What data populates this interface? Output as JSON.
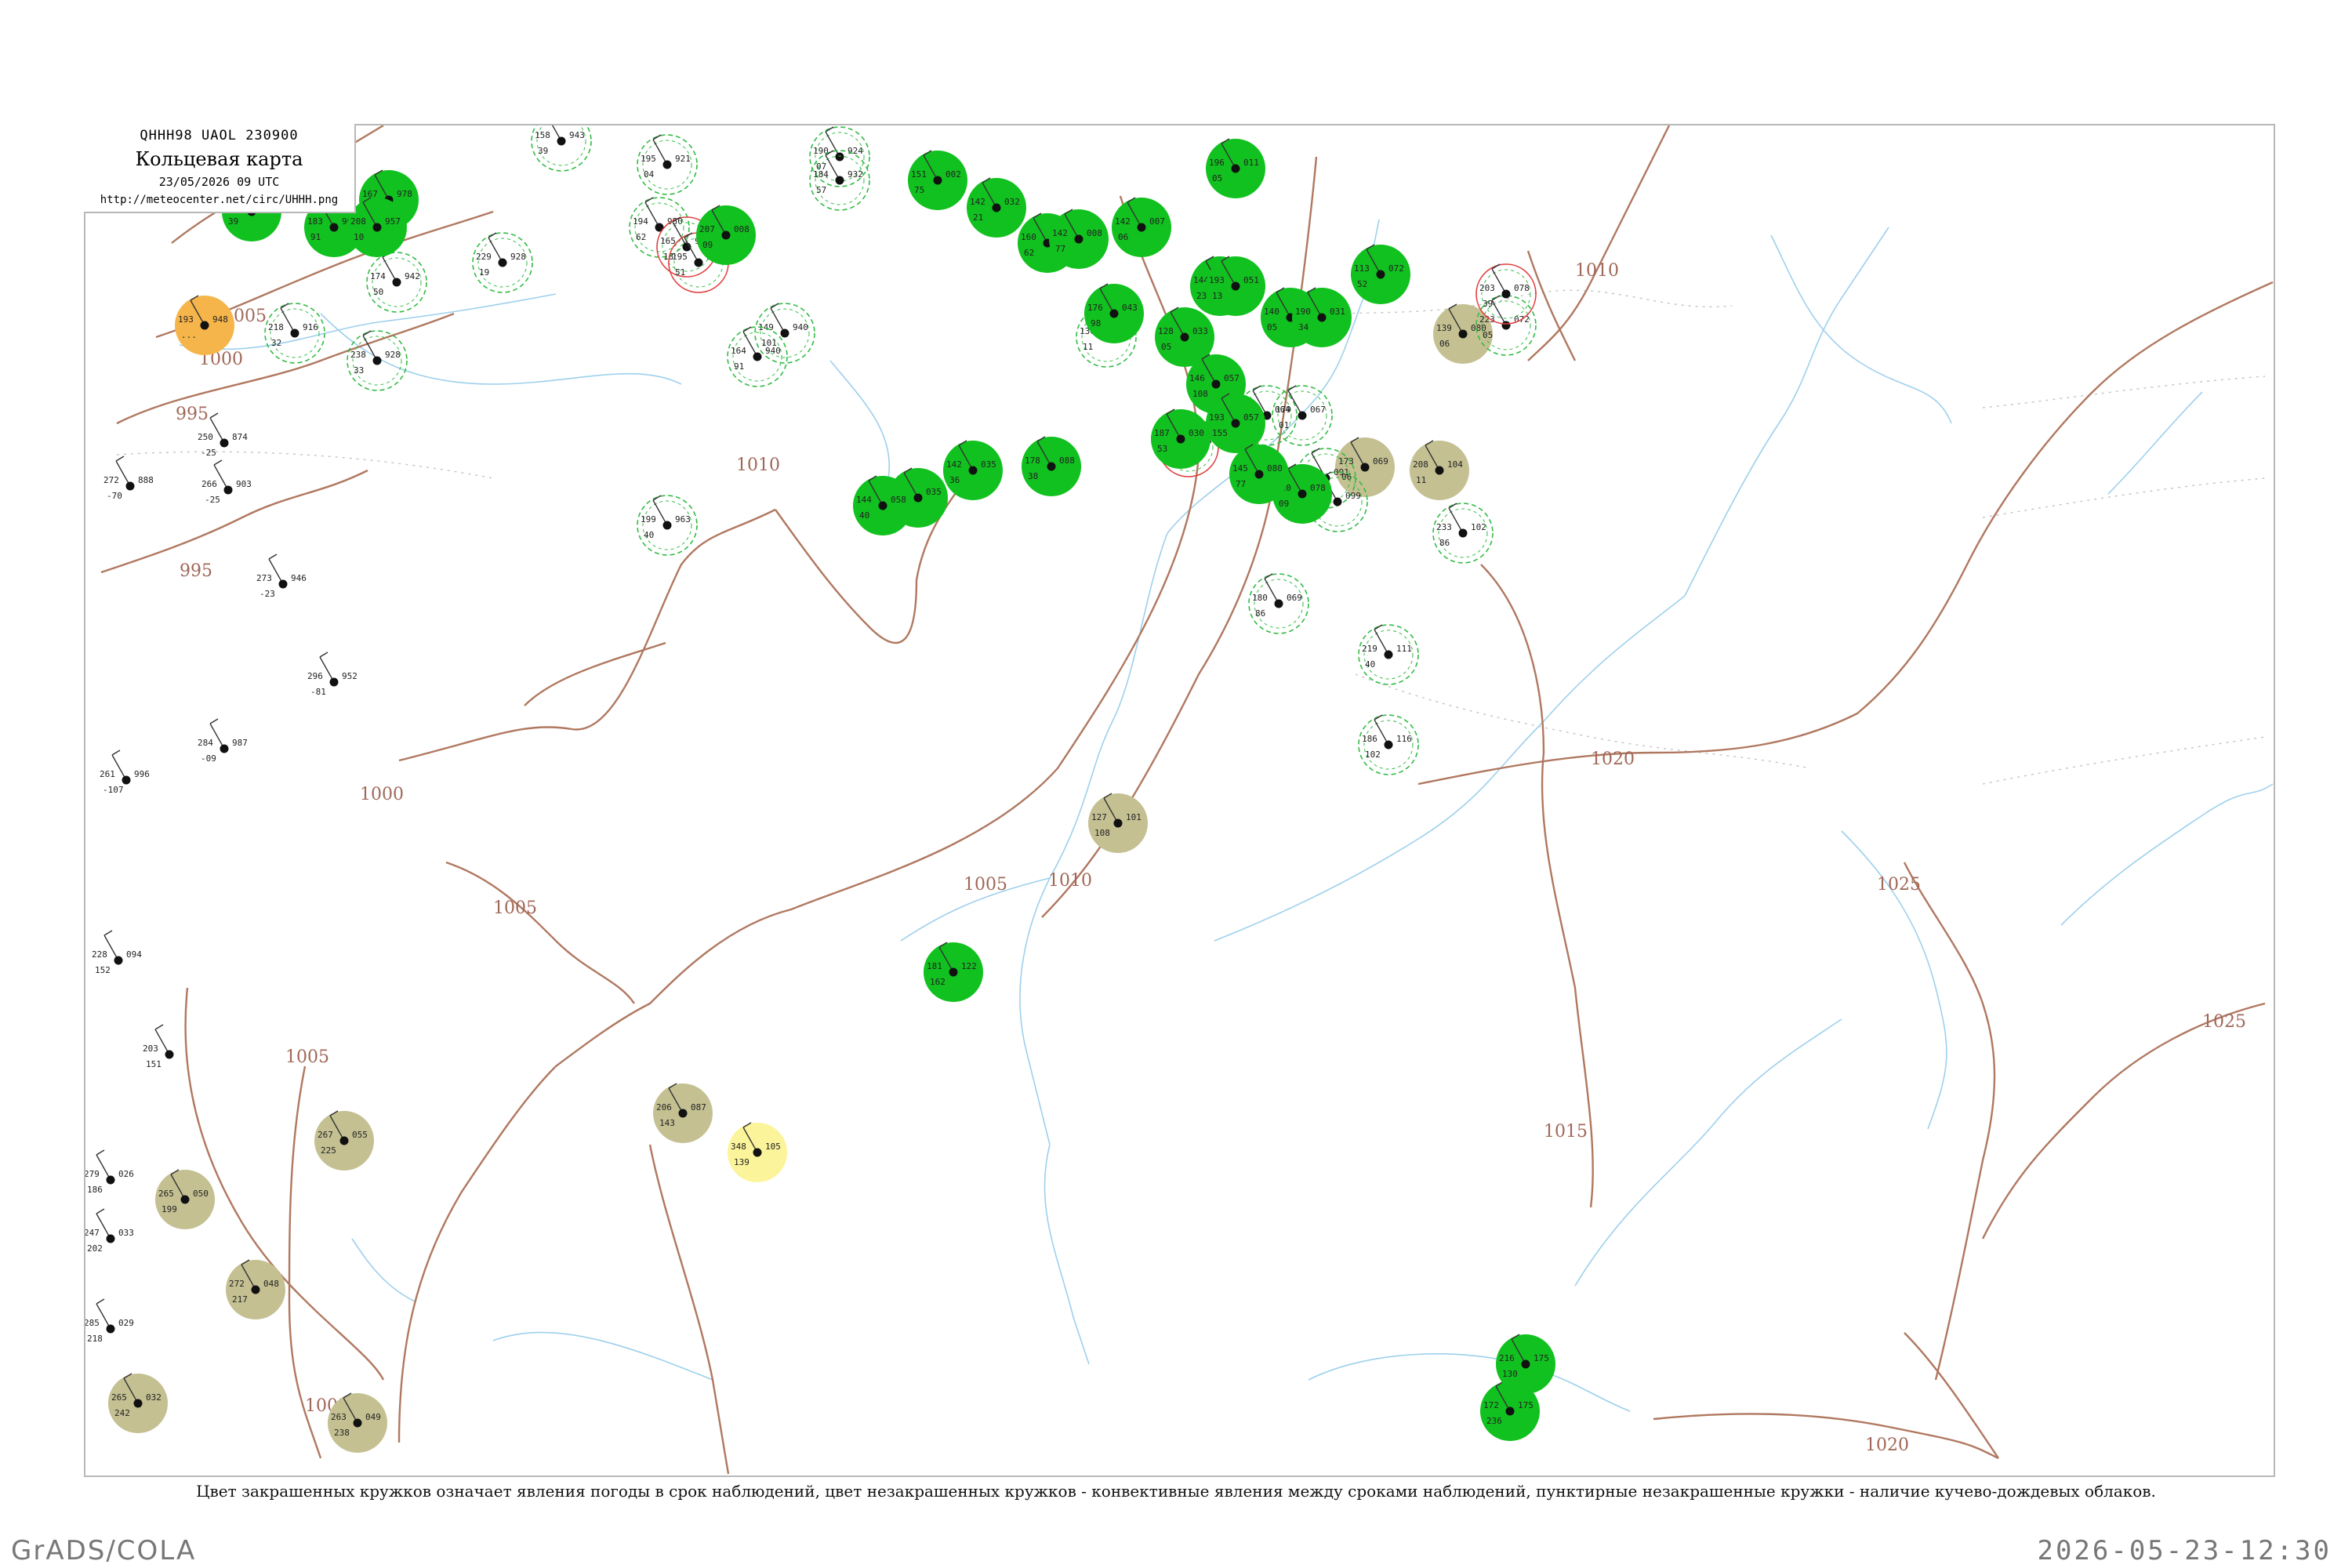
{
  "header": {
    "code": "QHHH98  UAOL  230900",
    "title": "Кольцевая карта",
    "date": "23/05/2026 09 UTC",
    "url": "http://meteocenter.net/circ/UHHH.png"
  },
  "caption": "Цвет закрашенных кружков означает явления погоды в срок наблюдений, цвет незакрашенных кружков - конвективные явления между сроками наблюдений, пунктирные незакрашенные кружки - наличие кучево-дождевых облаков.",
  "footer": {
    "left": "GrADS/COLA",
    "right": "2026-05-23-12:30"
  },
  "colors": {
    "isobar": "#b07860",
    "river": "#9ed0ec",
    "rain_fill": "#11c11f",
    "haze_fill": "#c4c092",
    "dust_fill": "#f6b54a",
    "fog_fill": "#fbf49a",
    "cb_ring": "#33bb44",
    "thunder_ring": "#e04040"
  },
  "isobar_labels": [
    "1005",
    "1000",
    "995",
    "995",
    "1000",
    "1010",
    "1005",
    "1005",
    "1005",
    "1005",
    "1010",
    "1010",
    "1015",
    "1020",
    "1025",
    "1025",
    "1020"
  ],
  "stations": [
    {
      "p": "193",
      "dp": "948",
      "t": "...",
      "type": "dust"
    },
    {
      "p": "250",
      "dp": "874",
      "t": "-25",
      "type": "plain"
    },
    {
      "p": "272",
      "dp": "888",
      "t": "-70",
      "type": "plain"
    },
    {
      "p": "266",
      "dp": "903",
      "t": "-25",
      "type": "plain"
    },
    {
      "p": "273",
      "dp": "946",
      "t": "-23",
      "type": "plain"
    },
    {
      "p": "296",
      "dp": "952",
      "t": "-81",
      "type": "plain"
    },
    {
      "p": "261",
      "dp": "996",
      "t": "-107",
      "type": "plain"
    },
    {
      "p": "284",
      "dp": "987",
      "t": "-09",
      "type": "plain"
    },
    {
      "p": "228",
      "dp": "094",
      "t": "152",
      "type": "plain"
    },
    {
      "p": "203",
      "dp": "",
      "t": "151",
      "type": "plain"
    },
    {
      "p": "279",
      "dp": "026",
      "t": "186",
      "type": "plain"
    },
    {
      "p": "247",
      "dp": "033",
      "t": "202",
      "type": "plain"
    },
    {
      "p": "285",
      "dp": "029",
      "t": "218",
      "type": "plain"
    },
    {
      "p": "265",
      "dp": "032",
      "t": "242",
      "type": "haze"
    },
    {
      "p": "265",
      "dp": "050",
      "t": "199",
      "type": "haze"
    },
    {
      "p": "267",
      "dp": "055",
      "t": "225",
      "type": "haze"
    },
    {
      "p": "272",
      "dp": "048",
      "t": "217",
      "type": "haze"
    },
    {
      "p": "263",
      "dp": "049",
      "t": "238",
      "type": "haze"
    },
    {
      "p": "206",
      "dp": "087",
      "t": "143",
      "type": "haze"
    },
    {
      "p": "127",
      "dp": "101",
      "t": "108",
      "type": "haze"
    },
    {
      "p": "208",
      "dp": "104",
      "t": "11",
      "type": "haze"
    },
    {
      "p": "173",
      "dp": "069",
      "t": "06",
      "type": "haze"
    },
    {
      "p": "139",
      "dp": "080",
      "t": "06",
      "type": "haze"
    },
    {
      "p": "348",
      "dp": "105",
      "t": "139",
      "type": "fog"
    },
    {
      "p": "158",
      "dp": "943",
      "t": "39",
      "type": "cb"
    },
    {
      "p": "174",
      "dp": "942",
      "t": "50",
      "type": "cb"
    },
    {
      "p": "218",
      "dp": "916",
      "t": "32",
      "type": "cb"
    },
    {
      "p": "238",
      "dp": "928",
      "t": "33",
      "type": "cb"
    },
    {
      "p": "229",
      "dp": "928",
      "t": "19",
      "type": "cb"
    },
    {
      "p": "195",
      "dp": "921",
      "t": "04",
      "type": "cb"
    },
    {
      "p": "194",
      "dp": "950",
      "t": "62",
      "type": "cb"
    },
    {
      "p": "190",
      "dp": "924",
      "t": "07",
      "type": "cb"
    },
    {
      "p": "184",
      "dp": "932",
      "t": "57",
      "type": "cb"
    },
    {
      "p": "149",
      "dp": "940",
      "t": "101",
      "type": "cb"
    },
    {
      "p": "164",
      "dp": "940",
      "t": "91",
      "type": "cb"
    },
    {
      "p": "199",
      "dp": "963",
      "t": "40",
      "type": "cb"
    },
    {
      "p": "130",
      "dp": "009",
      "t": "11",
      "type": "cb"
    },
    {
      "p": "139",
      "dp": "064",
      "t": "39",
      "type": "cb"
    },
    {
      "p": "179",
      "dp": "067",
      "t": "01",
      "type": "cb"
    },
    {
      "p": "180",
      "dp": "069",
      "t": "86",
      "type": "cb"
    },
    {
      "p": "219",
      "dp": "111",
      "t": "40",
      "type": "cb"
    },
    {
      "p": "186",
      "dp": "116",
      "t": "102",
      "type": "cb"
    },
    {
      "p": "189",
      "dp": "091",
      "t": "19",
      "type": "cb"
    },
    {
      "p": "196",
      "dp": "099",
      "t": "64",
      "type": "cb"
    },
    {
      "p": "233",
      "dp": "102",
      "t": "86",
      "type": "cb"
    },
    {
      "p": "223",
      "dp": "072",
      "t": "05",
      "type": "cb"
    },
    {
      "p": "203",
      "dp": "078",
      "t": "39",
      "type": "thunder"
    },
    {
      "p": "165",
      "dp": "953",
      "t": "18",
      "type": "thunder"
    },
    {
      "p": "195",
      "dp": "952",
      "t": "51",
      "type": "thunder"
    },
    {
      "p": "166",
      "dp": "005",
      "t": "26",
      "type": "thunder"
    },
    {
      "p": "152",
      "dp": "963",
      "t": "39",
      "type": "rain"
    },
    {
      "p": "183",
      "dp": "961",
      "t": "91",
      "type": "rain"
    },
    {
      "p": "167",
      "dp": "978",
      "t": "60",
      "type": "rain"
    },
    {
      "p": "208",
      "dp": "957",
      "t": "10",
      "type": "rain"
    },
    {
      "p": "207",
      "dp": "008",
      "t": "09",
      "type": "rain"
    },
    {
      "p": "151",
      "dp": "002",
      "t": "75",
      "type": "rain"
    },
    {
      "p": "142",
      "dp": "032",
      "t": "21",
      "type": "rain"
    },
    {
      "p": "160",
      "dp": "006",
      "t": "62",
      "type": "rain"
    },
    {
      "p": "142",
      "dp": "008",
      "t": "77",
      "type": "rain"
    },
    {
      "p": "142",
      "dp": "007",
      "t": "06",
      "type": "rain"
    },
    {
      "p": "196",
      "dp": "011",
      "t": "05",
      "type": "rain"
    },
    {
      "p": "144",
      "dp": "019",
      "t": "23",
      "type": "rain"
    },
    {
      "p": "176",
      "dp": "043",
      "t": "98",
      "type": "rain"
    },
    {
      "p": "128",
      "dp": "033",
      "t": "05",
      "type": "rain"
    },
    {
      "p": "193",
      "dp": "051",
      "t": "13",
      "type": "rain"
    },
    {
      "p": "140",
      "dp": "063",
      "t": "05",
      "type": "rain"
    },
    {
      "p": "190",
      "dp": "031",
      "t": "34",
      "type": "rain"
    },
    {
      "p": "146",
      "dp": "057",
      "t": "108",
      "type": "rain"
    },
    {
      "p": "193",
      "dp": "057",
      "t": "155",
      "type": "rain"
    },
    {
      "p": "187",
      "dp": "030",
      "t": "53",
      "type": "rain"
    },
    {
      "p": "178",
      "dp": "088",
      "t": "38",
      "type": "rain"
    },
    {
      "p": "134",
      "dp": "035",
      "t": "28",
      "type": "rain"
    },
    {
      "p": "142",
      "dp": "035",
      "t": "36",
      "type": "rain"
    },
    {
      "p": "144",
      "dp": "058",
      "t": "40",
      "type": "rain"
    },
    {
      "p": "120",
      "dp": "078",
      "t": "09",
      "type": "rain"
    },
    {
      "p": "113",
      "dp": "072",
      "t": "52",
      "type": "rain"
    },
    {
      "p": "145",
      "dp": "080",
      "t": "77",
      "type": "rain"
    },
    {
      "p": "181",
      "dp": "122",
      "t": "162",
      "type": "rain"
    },
    {
      "p": "172",
      "dp": "175",
      "t": "236",
      "type": "rain"
    },
    {
      "p": "216",
      "dp": "175",
      "t": "130",
      "type": "rain"
    }
  ]
}
